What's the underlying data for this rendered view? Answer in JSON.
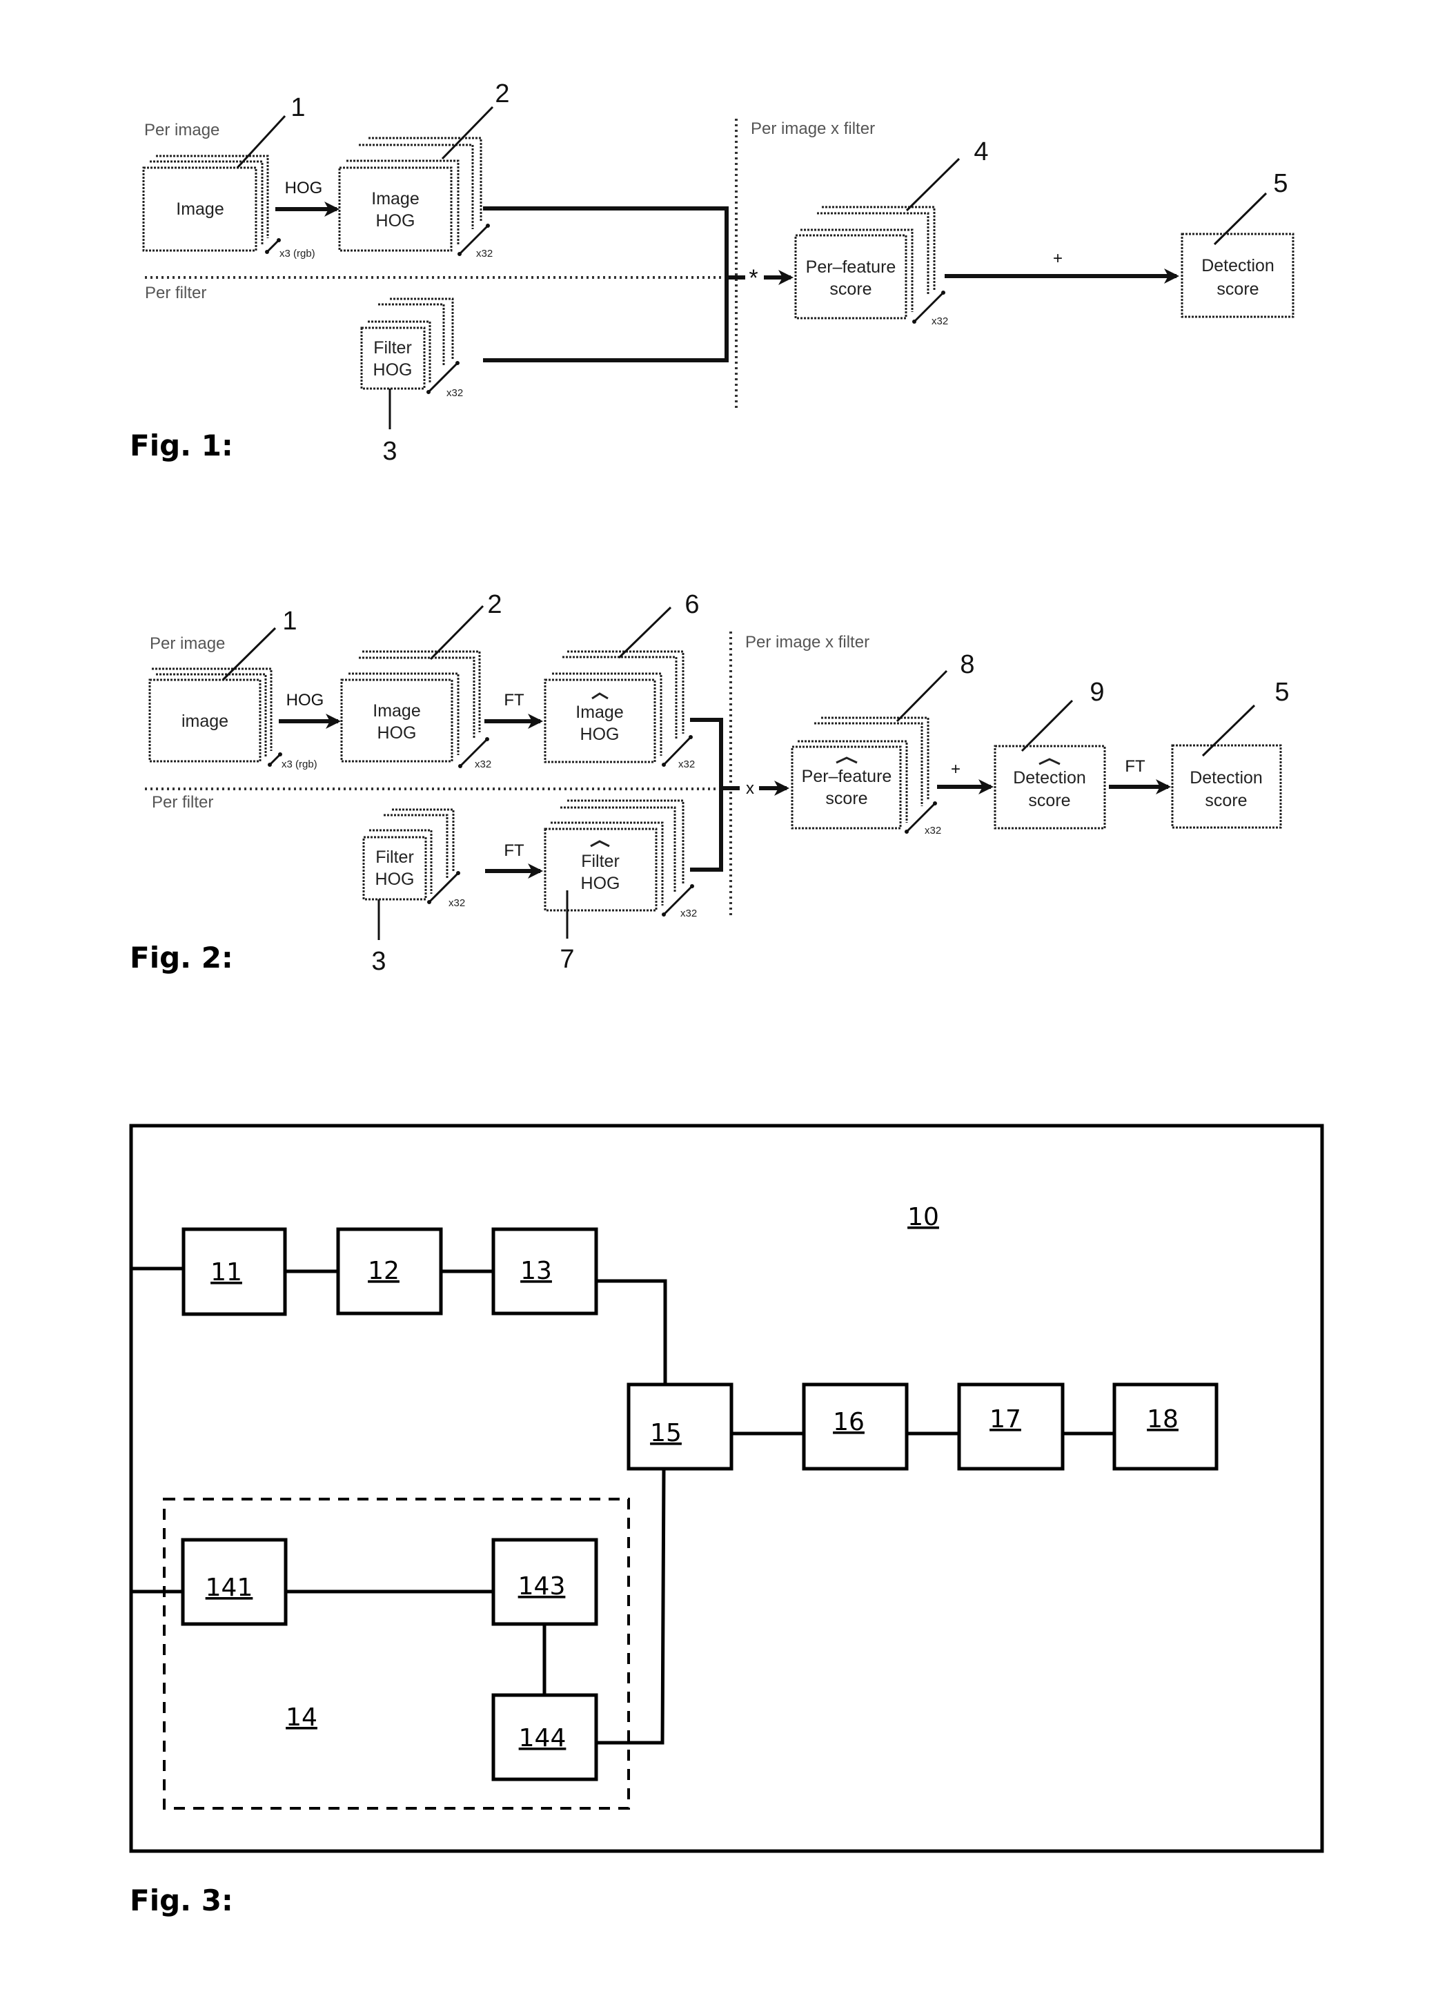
{
  "fig1": {
    "caption": "Fig. 1:",
    "regions": {
      "per_image": "Per image",
      "per_filter": "Per filter",
      "per_image_x_filter": "Per image x filter"
    },
    "boxes": {
      "image": {
        "ref": "1",
        "lines": [
          "Image"
        ],
        "count": "x3 (rgb)"
      },
      "image_hog": {
        "ref": "2",
        "lines": [
          "Image",
          "HOG"
        ],
        "count": "x32"
      },
      "filter_hog": {
        "ref": "3",
        "lines": [
          "Filter",
          "HOG"
        ],
        "count": "x32"
      },
      "per_feature_score": {
        "ref": "4",
        "lines": [
          "Per–feature",
          "score"
        ],
        "count": "x32"
      },
      "detection_score": {
        "ref": "5",
        "lines": [
          "Detection",
          "score"
        ]
      }
    },
    "ops": {
      "hog": "HOG",
      "conv": "*",
      "sum": "+"
    }
  },
  "fig2": {
    "caption": "Fig. 2:",
    "regions": {
      "per_image": "Per image",
      "per_filter": "Per filter",
      "per_image_x_filter": "Per image x filter"
    },
    "boxes": {
      "image": {
        "ref": "1",
        "lines": [
          "image"
        ],
        "count": "x3 (rgb)"
      },
      "image_hog": {
        "ref": "2",
        "lines": [
          "Image",
          "HOG"
        ],
        "count": "x32"
      },
      "image_hog_ft": {
        "ref": "6",
        "lines": [
          "Image",
          "HOG"
        ],
        "count": "x32",
        "hat": true
      },
      "filter_hog": {
        "ref": "3",
        "lines": [
          "Filter",
          "HOG"
        ],
        "count": "x32"
      },
      "filter_hog_ft": {
        "ref": "7",
        "lines": [
          "Filter",
          "HOG"
        ],
        "count": "x32",
        "hat": true
      },
      "per_feature_score_ft": {
        "ref": "8",
        "lines": [
          "Per–feature",
          "score"
        ],
        "count": "x32",
        "hat": true
      },
      "detection_score_ft": {
        "ref": "9",
        "lines": [
          "Detection",
          "score"
        ],
        "hat": true
      },
      "detection_score": {
        "ref": "5",
        "lines": [
          "Detection",
          "score"
        ]
      }
    },
    "ops": {
      "hog": "HOG",
      "ft": "FT",
      "mult": "x",
      "sum": "+"
    }
  },
  "fig3": {
    "caption": "Fig. 3:",
    "system": "10",
    "subsystem": "14",
    "blocks": [
      "11",
      "12",
      "13",
      "15",
      "16",
      "17",
      "18",
      "141",
      "143",
      "144"
    ]
  }
}
